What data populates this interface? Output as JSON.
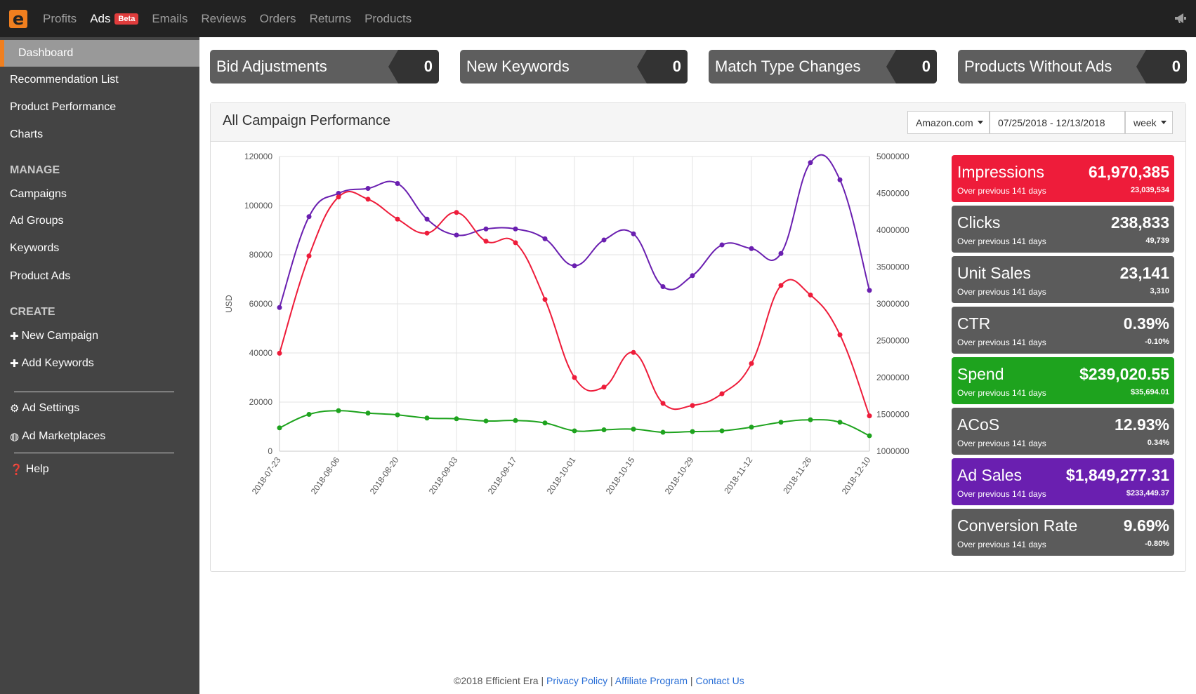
{
  "topnav": {
    "logo_letter": "e",
    "links": [
      "Profits",
      "Ads",
      "Emails",
      "Reviews",
      "Orders",
      "Returns",
      "Products"
    ],
    "beta_badge": "Beta",
    "active": "Ads",
    "right_icon": "megaphone-icon"
  },
  "sidebar": {
    "items_top": [
      "Dashboard",
      "Recommendation List",
      "Product Performance",
      "Charts"
    ],
    "manage_heading": "MANAGE",
    "manage_items": [
      "Campaigns",
      "Ad Groups",
      "Keywords",
      "Product Ads"
    ],
    "create_heading": "CREATE",
    "create_items": [
      "New Campaign",
      "Add Keywords"
    ],
    "settings_items": [
      "Ad Settings",
      "Ad Marketplaces"
    ],
    "help": "Help",
    "accent_color": "#f07f1f"
  },
  "tiles": [
    {
      "label": "Bid Adjustments",
      "count": "0"
    },
    {
      "label": "New Keywords",
      "count": "0"
    },
    {
      "label": "Match Type Changes",
      "count": "0"
    },
    {
      "label": "Products Without Ads",
      "count": "0"
    }
  ],
  "panel": {
    "title": "All Campaign Performance",
    "marketplace": "Amazon.com",
    "date_range": "07/25/2018 - 12/13/2018",
    "interval": "week"
  },
  "metrics": [
    {
      "label": "Impressions",
      "value": "61,970,385",
      "sub": "Over previous 141 days",
      "prev": "23,039,534",
      "color": "#ee1c3a"
    },
    {
      "label": "Clicks",
      "value": "238,833",
      "sub": "Over previous 141 days",
      "prev": "49,739",
      "color": "#5b5b5b"
    },
    {
      "label": "Unit Sales",
      "value": "23,141",
      "sub": "Over previous 141 days",
      "prev": "3,310",
      "color": "#5b5b5b"
    },
    {
      "label": "CTR",
      "value": "0.39%",
      "sub": "Over previous 141 days",
      "prev": "-0.10%",
      "color": "#5b5b5b"
    },
    {
      "label": "Spend",
      "value": "$239,020.55",
      "sub": "Over previous 141 days",
      "prev": "$35,694.01",
      "color": "#1ea31e"
    },
    {
      "label": "ACoS",
      "value": "12.93%",
      "sub": "Over previous 141 days",
      "prev": "0.34%",
      "color": "#5b5b5b"
    },
    {
      "label": "Ad Sales",
      "value": "$1,849,277.31",
      "sub": "Over previous 141 days",
      "prev": "$233,449.37",
      "color": "#6a1fb0"
    },
    {
      "label": "Conversion Rate",
      "value": "9.69%",
      "sub": "Over previous 141 days",
      "prev": "-0.80%",
      "color": "#5b5b5b"
    }
  ],
  "chart_data": {
    "type": "line",
    "ylabel": "USD",
    "x": [
      "2018-07-23",
      "2018-07-30",
      "2018-08-06",
      "2018-08-13",
      "2018-08-20",
      "2018-08-27",
      "2018-09-03",
      "2018-09-10",
      "2018-09-17",
      "2018-09-24",
      "2018-10-01",
      "2018-10-08",
      "2018-10-15",
      "2018-10-22",
      "2018-10-29",
      "2018-11-05",
      "2018-11-12",
      "2018-11-19",
      "2018-11-26",
      "2018-12-03",
      "2018-12-10"
    ],
    "x_tick_labels": [
      "2018-07-23",
      "2018-08-06",
      "2018-08-20",
      "2018-09-03",
      "2018-09-17",
      "2018-10-01",
      "2018-10-15",
      "2018-10-29",
      "2018-11-12",
      "2018-11-26",
      "2018-12-10"
    ],
    "ylim_left": [
      0,
      120000
    ],
    "yticks_left": [
      "0",
      "20000",
      "40000",
      "60000",
      "80000",
      "100000",
      "120000"
    ],
    "ylim_right": [
      1000000,
      5000000
    ],
    "yticks_right": [
      "1000000",
      "1500000",
      "2000000",
      "2500000",
      "3000000",
      "3500000",
      "4000000",
      "4500000",
      "5000000"
    ],
    "grid": true,
    "series": [
      {
        "color": "#6a1fb0",
        "axis": "left",
        "values": [
          58500,
          95500,
          105000,
          107000,
          109000,
          94500,
          88000,
          90500,
          90500,
          86500,
          75500,
          86000,
          88500,
          67000,
          71500,
          84000,
          82500,
          80500,
          117500,
          110500,
          65500
        ]
      },
      {
        "color": "#ee1c3a",
        "axis": "right",
        "values": [
          2330000,
          3650000,
          4450000,
          4420000,
          4150000,
          3960000,
          4240000,
          3850000,
          3830000,
          3060000,
          2000000,
          1870000,
          2340000,
          1650000,
          1620000,
          1780000,
          2190000,
          3250000,
          3120000,
          2580000,
          1480000
        ]
      },
      {
        "color": "#1ea31e",
        "axis": "left",
        "values": [
          9500,
          15000,
          16500,
          15500,
          14800,
          13500,
          13200,
          12300,
          12500,
          11500,
          8300,
          8700,
          9000,
          7700,
          8000,
          8300,
          9800,
          11800,
          12800,
          11800,
          6300
        ]
      }
    ]
  },
  "footer": {
    "copyright": "©2018 Efficient Era",
    "sep": " | ",
    "links": [
      "Privacy Policy",
      "Affiliate Program",
      "Contact Us"
    ]
  }
}
